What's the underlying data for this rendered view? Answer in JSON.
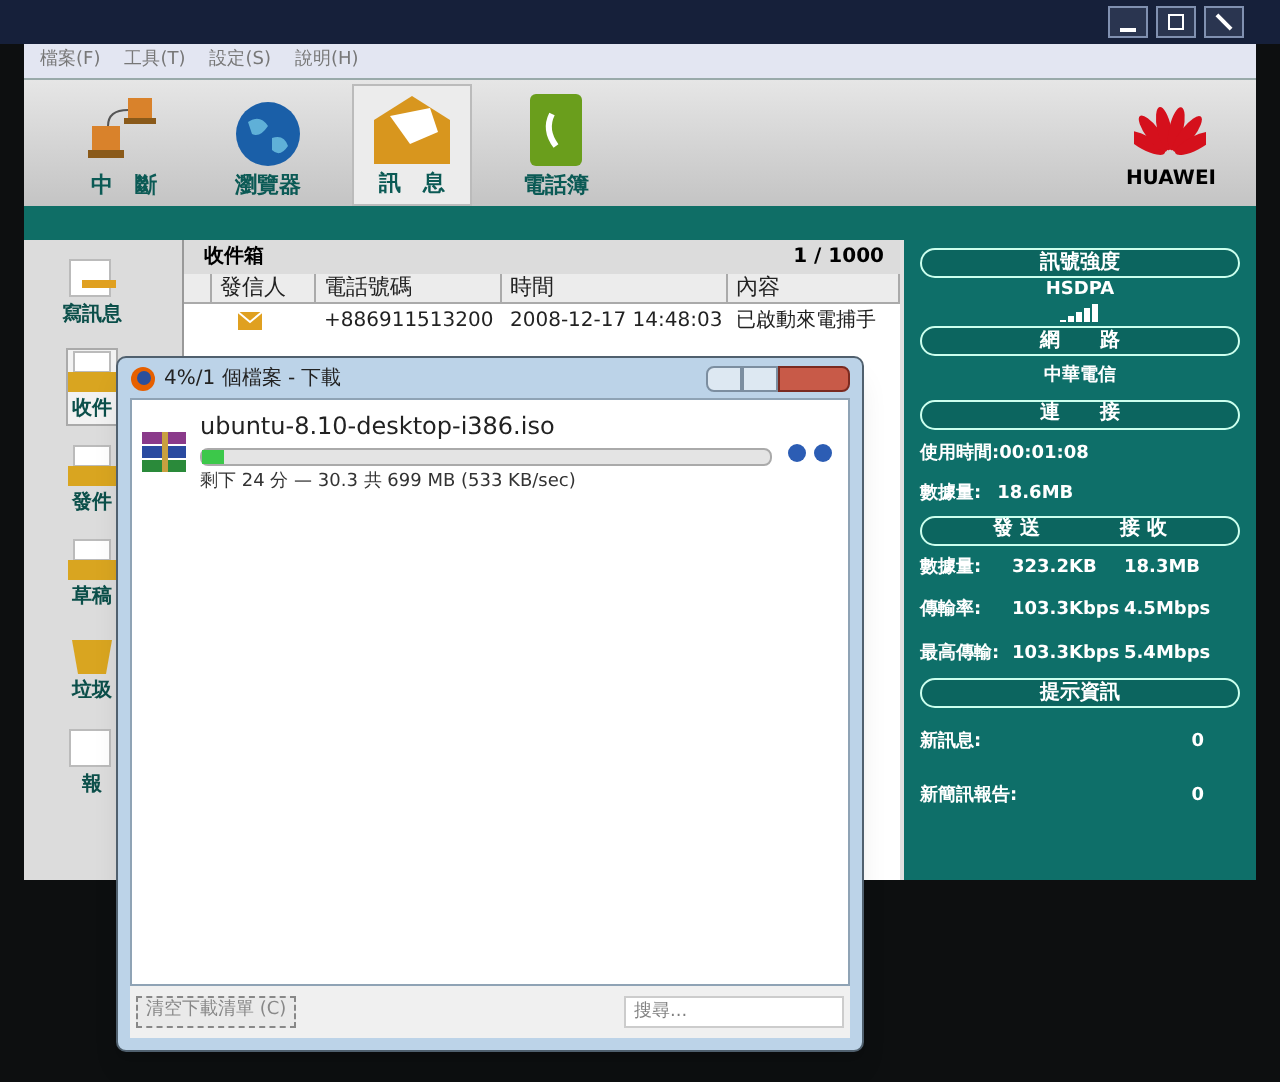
{
  "app_window": {
    "menu": [
      "檔案(F)",
      "工具(T)",
      "設定(S)",
      "說明(H)"
    ],
    "toolbar": [
      {
        "label": "中　斷",
        "kind": "network",
        "selected": false
      },
      {
        "label": "瀏覽器",
        "kind": "globe",
        "selected": false
      },
      {
        "label": "訊　息",
        "kind": "envelope",
        "selected": true
      },
      {
        "label": "電話簿",
        "kind": "phonebook",
        "selected": false
      }
    ],
    "logo": "HUAWEI",
    "sidebar": [
      {
        "label": "寫訊息",
        "kind": "write",
        "selected": false
      },
      {
        "label": "收件",
        "kind": "inbox",
        "selected": true
      },
      {
        "label": "發件",
        "kind": "outbox",
        "selected": false
      },
      {
        "label": "草稿",
        "kind": "drafts",
        "selected": false
      },
      {
        "label": "垃圾",
        "kind": "trash",
        "selected": false
      },
      {
        "label": "報",
        "kind": "report",
        "selected": false
      }
    ],
    "inbox": {
      "title": "收件箱",
      "count": "1 / 1000",
      "columns": [
        "發信人",
        "電話號碼",
        "時間",
        "內容"
      ],
      "rows": [
        {
          "unread": true,
          "phone": "+886911513200",
          "time": "2008-12-17 14:48:03",
          "content": "已啟動來電捕手"
        }
      ]
    },
    "status_panel": {
      "signal_header": "訊號強度",
      "network_type": "HSDPA",
      "network_header": "網　　路",
      "carrier": "中華電信",
      "connect_header": "連　　接",
      "usage_time": "使用時間:00:01:08",
      "data_label": "數據量:",
      "data_value": "18.6MB",
      "send_header": "發 送",
      "receive_header": "接 收",
      "stats": [
        {
          "label": "數據量:",
          "send": "323.2KB",
          "receive": "18.3MB"
        },
        {
          "label": "傳輸率:",
          "send": "103.3Kbps",
          "receive": "4.5Mbps"
        },
        {
          "label": "最高傳輸:",
          "send": "103.3Kbps",
          "receive": "5.4Mbps"
        }
      ],
      "info_header": "提示資訊",
      "info": [
        {
          "label": "新訊息:",
          "value": "0"
        },
        {
          "label": "新簡訊報告:",
          "value": "0"
        }
      ]
    }
  },
  "download_window": {
    "title": "4%/1 個檔案 - 下載",
    "downloads": [
      {
        "filename": "ubuntu-8.10-desktop-i386.iso",
        "level": 0.04,
        "status": "剩下 24 分 — 30.3 共 699 MB (533 KB/sec)"
      }
    ],
    "clear_button": "清空下載清單 (C)",
    "search": {
      "placeholder": "搜尋..."
    }
  }
}
